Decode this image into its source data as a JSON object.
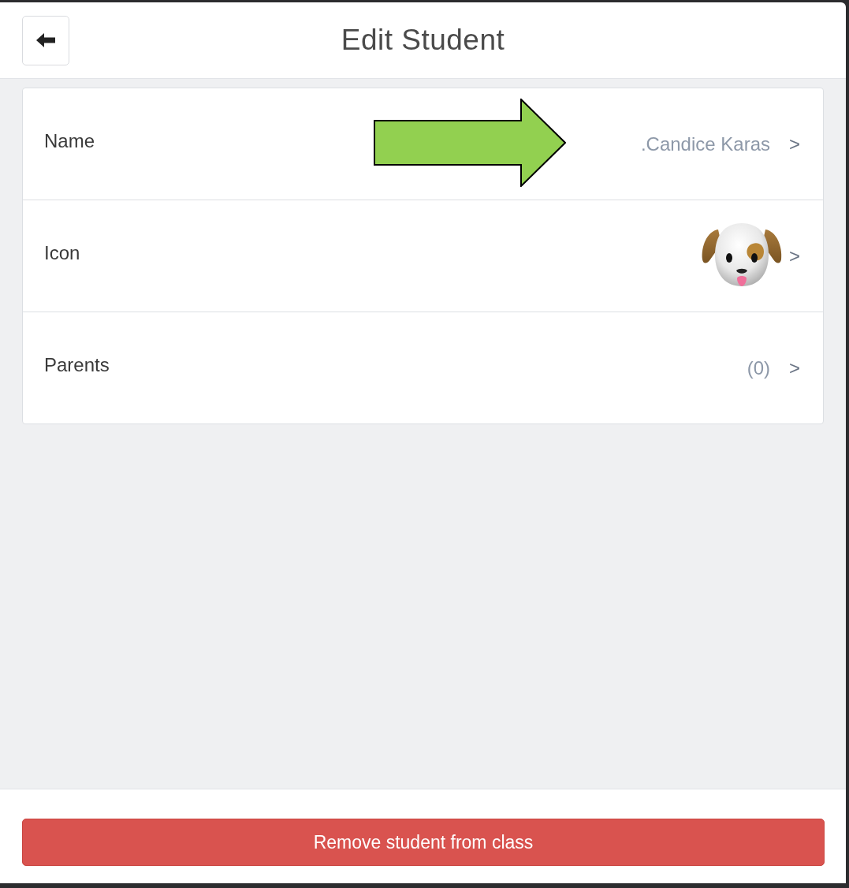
{
  "header": {
    "title": "Edit Student"
  },
  "rows": [
    {
      "kind": "text",
      "label": "Name",
      "value": ".Candice Karas",
      "chevron": ">"
    },
    {
      "kind": "icon",
      "label": "Icon",
      "chevron": ">"
    },
    {
      "kind": "text",
      "label": "Parents",
      "value": "(0)",
      "chevron": ">"
    }
  ],
  "annotations": [
    {
      "kind": "arrow"
    }
  ],
  "footer": {
    "button": "Remove student from class"
  }
}
